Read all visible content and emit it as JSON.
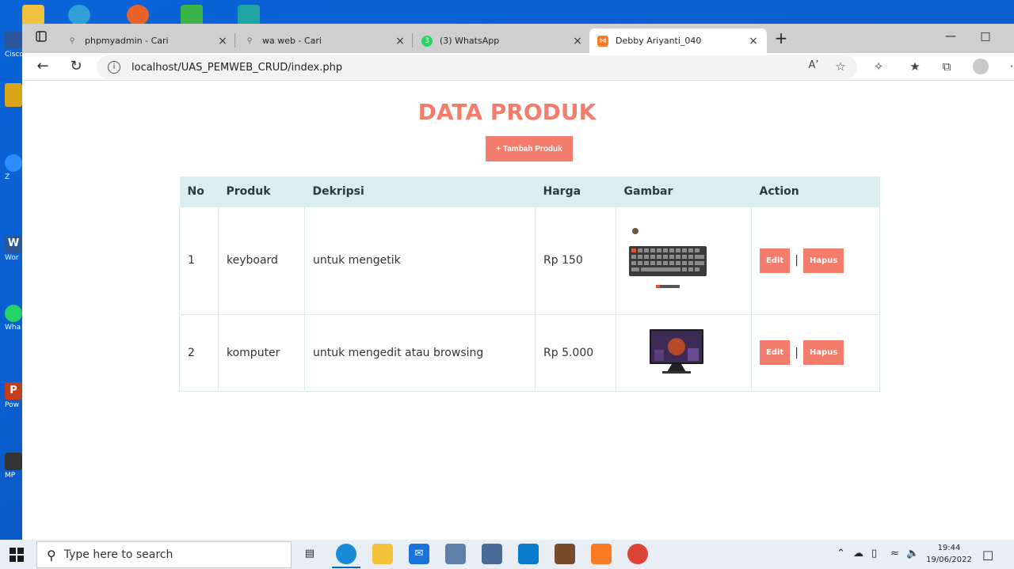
{
  "desktop": {
    "icons": [
      {
        "label": "Cisco",
        "color": "#2b579a",
        "glyph": "C"
      },
      {
        "label": "",
        "color": "#d9a418",
        "glyph": ""
      },
      {
        "label": "Z",
        "color": "#2d8cff",
        "glyph": "Z"
      },
      {
        "label": "Wor",
        "color": "#2b579a",
        "glyph": "W"
      },
      {
        "label": "Wha",
        "color": "#25d366",
        "glyph": "W"
      },
      {
        "label": "Pow",
        "color": "#c43e1c",
        "glyph": "P"
      },
      {
        "label": "MP",
        "color": "#333333",
        "glyph": "M"
      }
    ]
  },
  "browser": {
    "tabs": [
      {
        "title": "phpmyadmin - Cari",
        "icon": "search-icon",
        "close": "×"
      },
      {
        "title": "wa web - Cari",
        "icon": "search-icon",
        "close": "×"
      },
      {
        "title": "(3) WhatsApp",
        "icon": "whatsapp-icon",
        "close": "×"
      },
      {
        "title": "Debby Ariyanti_040",
        "icon": "xampp-icon",
        "close": "×"
      }
    ],
    "new_tab": "+",
    "url": "localhost/UAS_PEMWEB_CRUD/index.php"
  },
  "page": {
    "title": "DATA PRODUK",
    "add_button": "+  Tambah Produk",
    "table": {
      "headers": [
        "No",
        "Produk",
        "Dekripsi",
        "Harga",
        "Gambar",
        "Action"
      ],
      "rows": [
        {
          "no": "1",
          "produk": "keyboard",
          "deskripsi": "untuk mengetik",
          "harga": "Rp 150",
          "image": "keyboard-image",
          "edit": "Edit",
          "sep": "|",
          "hapus": "Hapus"
        },
        {
          "no": "2",
          "produk": "komputer",
          "deskripsi": "untuk mengedit atau browsing",
          "harga": "Rp 5.000",
          "image": "monitor-image",
          "edit": "Edit",
          "sep": "|",
          "hapus": "Hapus"
        }
      ]
    }
  },
  "taskbar": {
    "search_placeholder": "Type here to search",
    "time": "19:44",
    "date": "19/06/2022"
  },
  "colors": {
    "accent": "#f47c6c",
    "table_header": "#d9eeee"
  }
}
